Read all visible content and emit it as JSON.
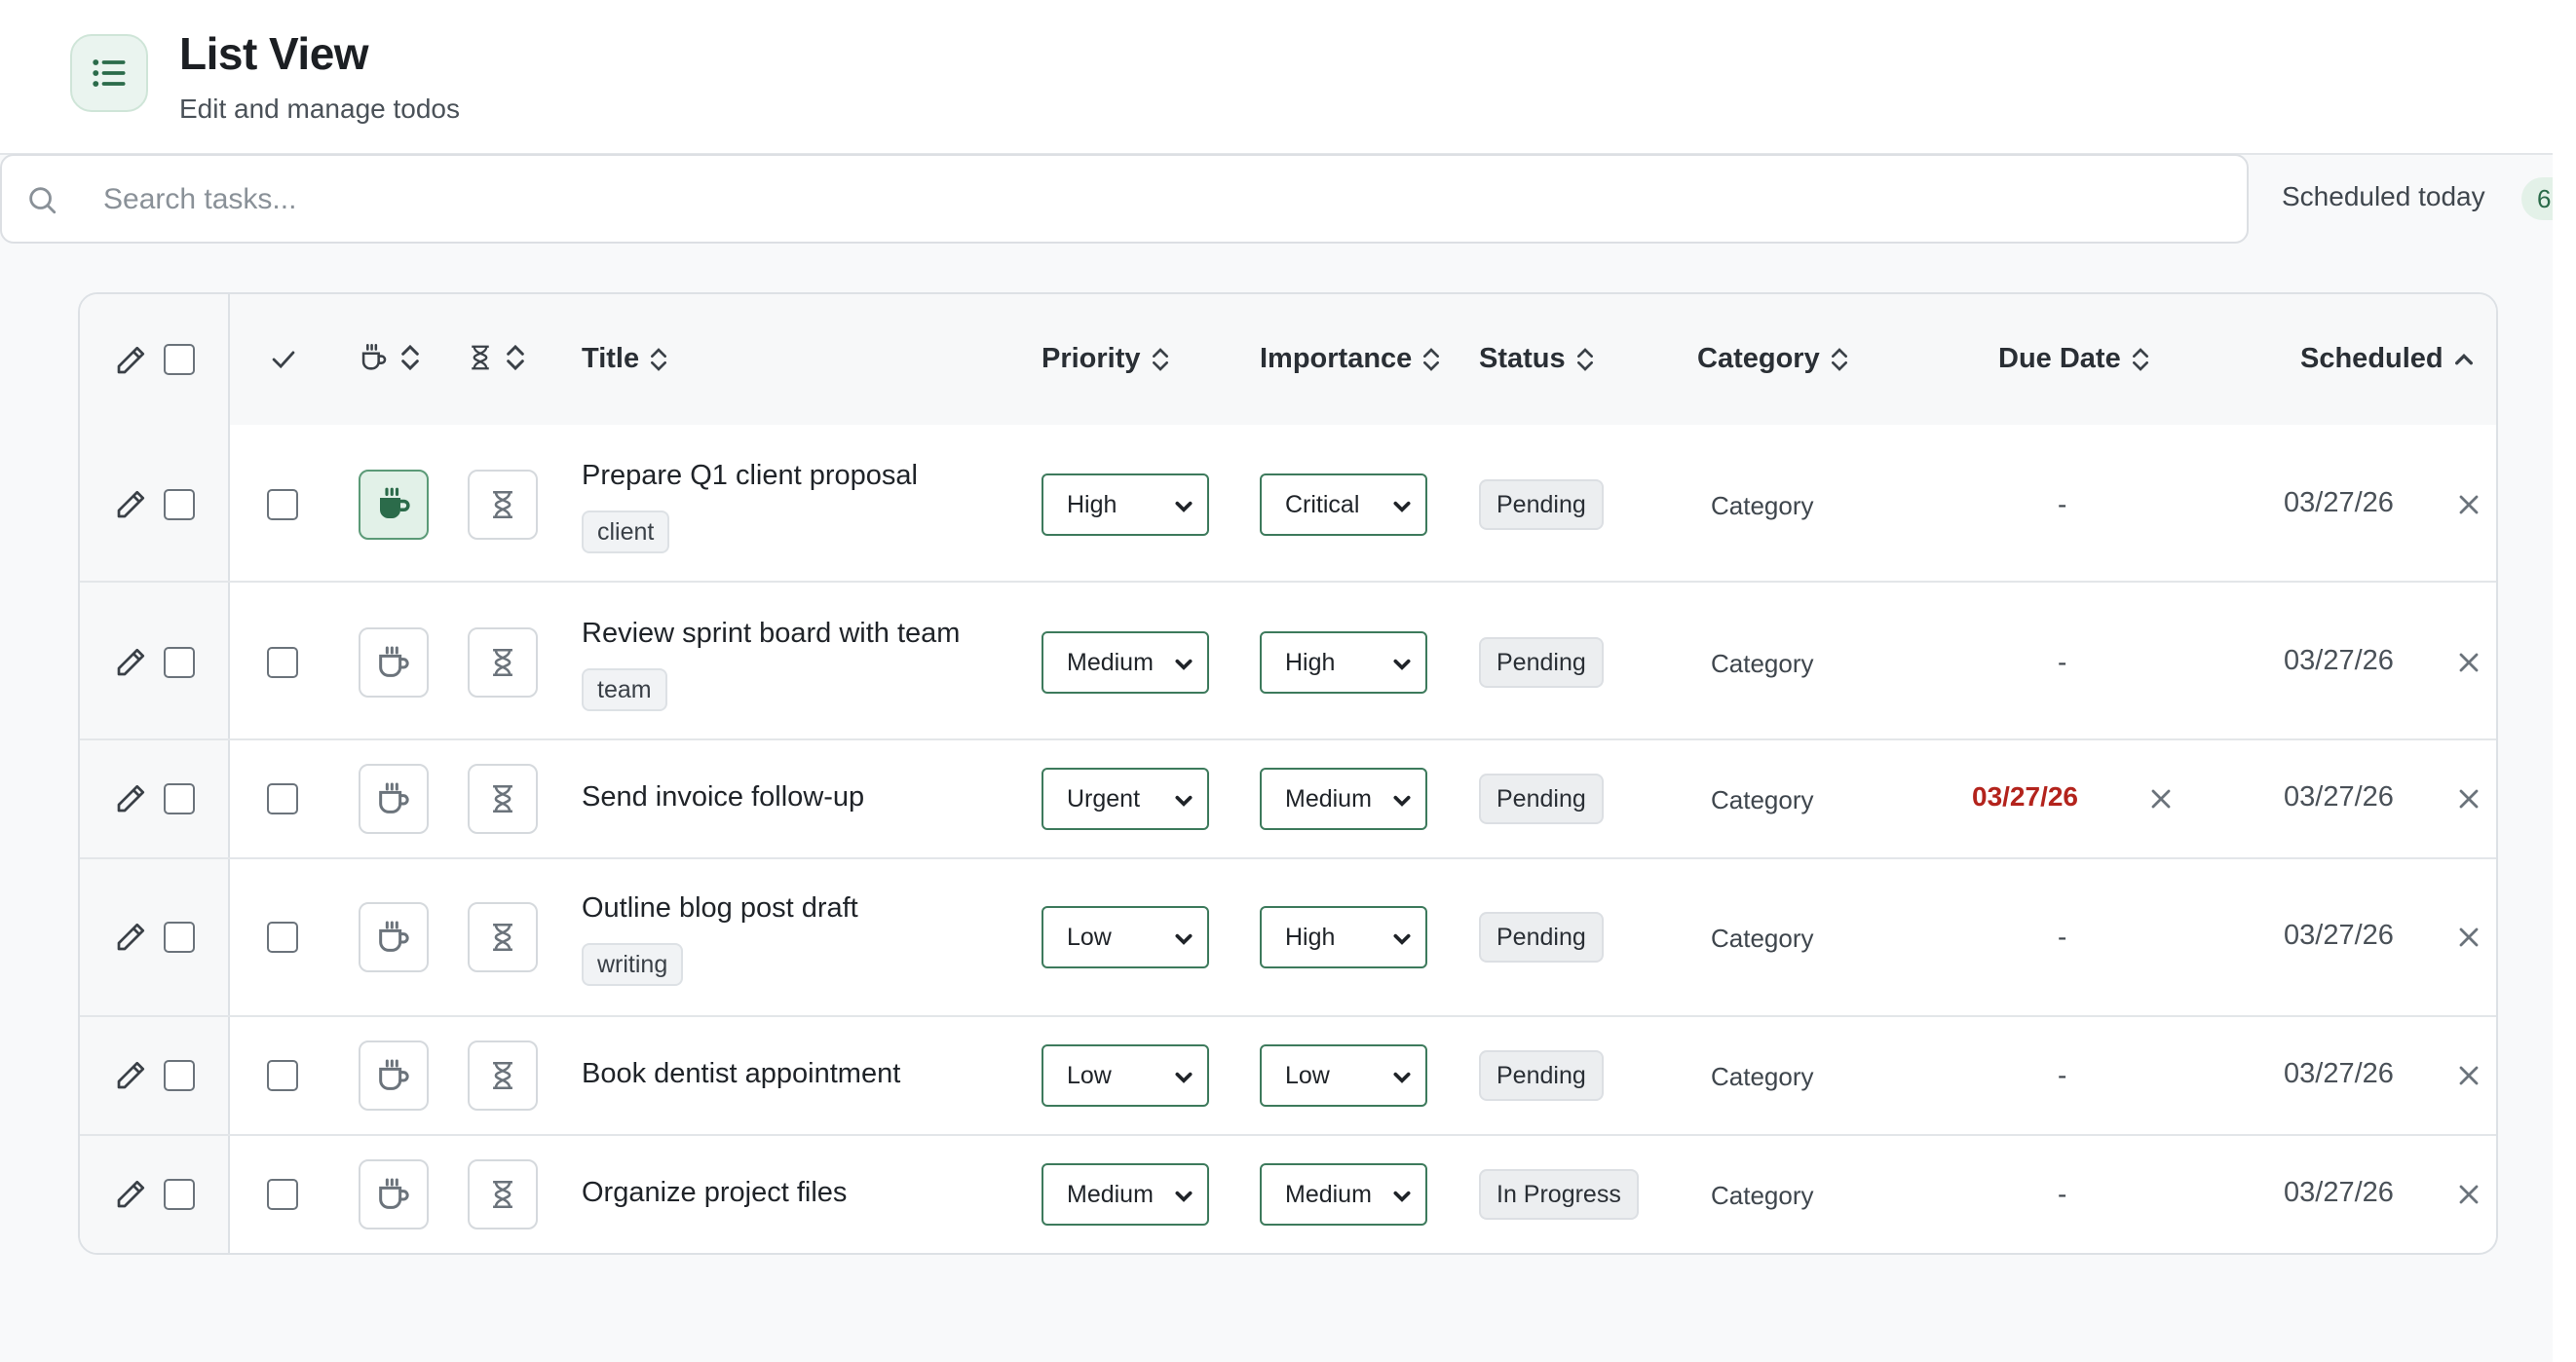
{
  "header": {
    "title": "List View",
    "subtitle": "Edit and manage todos",
    "icon": "list-icon"
  },
  "search": {
    "placeholder": "Search tasks...",
    "value": ""
  },
  "scheduled_today": {
    "label": "Scheduled today",
    "count": "6"
  },
  "columns": {
    "title": "Title",
    "priority": "Priority",
    "importance": "Importance",
    "status": "Status",
    "category": "Category",
    "due_date": "Due Date",
    "scheduled": "Scheduled"
  },
  "colors": {
    "accent": "#3d7a5c",
    "overdue": "#b3231c",
    "active_bg": "#e2f1e8"
  },
  "rows": [
    {
      "title": "Prepare Q1 client proposal",
      "tag": "client",
      "priority": "High",
      "importance": "Critical",
      "status": "Pending",
      "category": "Category",
      "due": "-",
      "scheduled": "03/27/26",
      "coffee_active": true
    },
    {
      "title": "Review sprint board with team",
      "tag": "team",
      "priority": "Medium",
      "importance": "High",
      "status": "Pending",
      "category": "Category",
      "due": "-",
      "scheduled": "03/27/26",
      "coffee_active": false
    },
    {
      "title": "Send invoice follow-up",
      "tag": "",
      "priority": "Urgent",
      "importance": "Medium",
      "status": "Pending",
      "category": "Category",
      "due": "03/27/26",
      "scheduled": "03/27/26",
      "coffee_active": false
    },
    {
      "title": "Outline blog post draft",
      "tag": "writing",
      "priority": "Low",
      "importance": "High",
      "status": "Pending",
      "category": "Category",
      "due": "-",
      "scheduled": "03/27/26",
      "coffee_active": false
    },
    {
      "title": "Book dentist appointment",
      "tag": "",
      "priority": "Low",
      "importance": "Low",
      "status": "Pending",
      "category": "Category",
      "due": "-",
      "scheduled": "03/27/26",
      "coffee_active": false
    },
    {
      "title": "Organize project files",
      "tag": "",
      "priority": "Medium",
      "importance": "Medium",
      "status": "In Progress",
      "category": "Category",
      "due": "-",
      "scheduled": "03/27/26",
      "coffee_active": false
    }
  ]
}
